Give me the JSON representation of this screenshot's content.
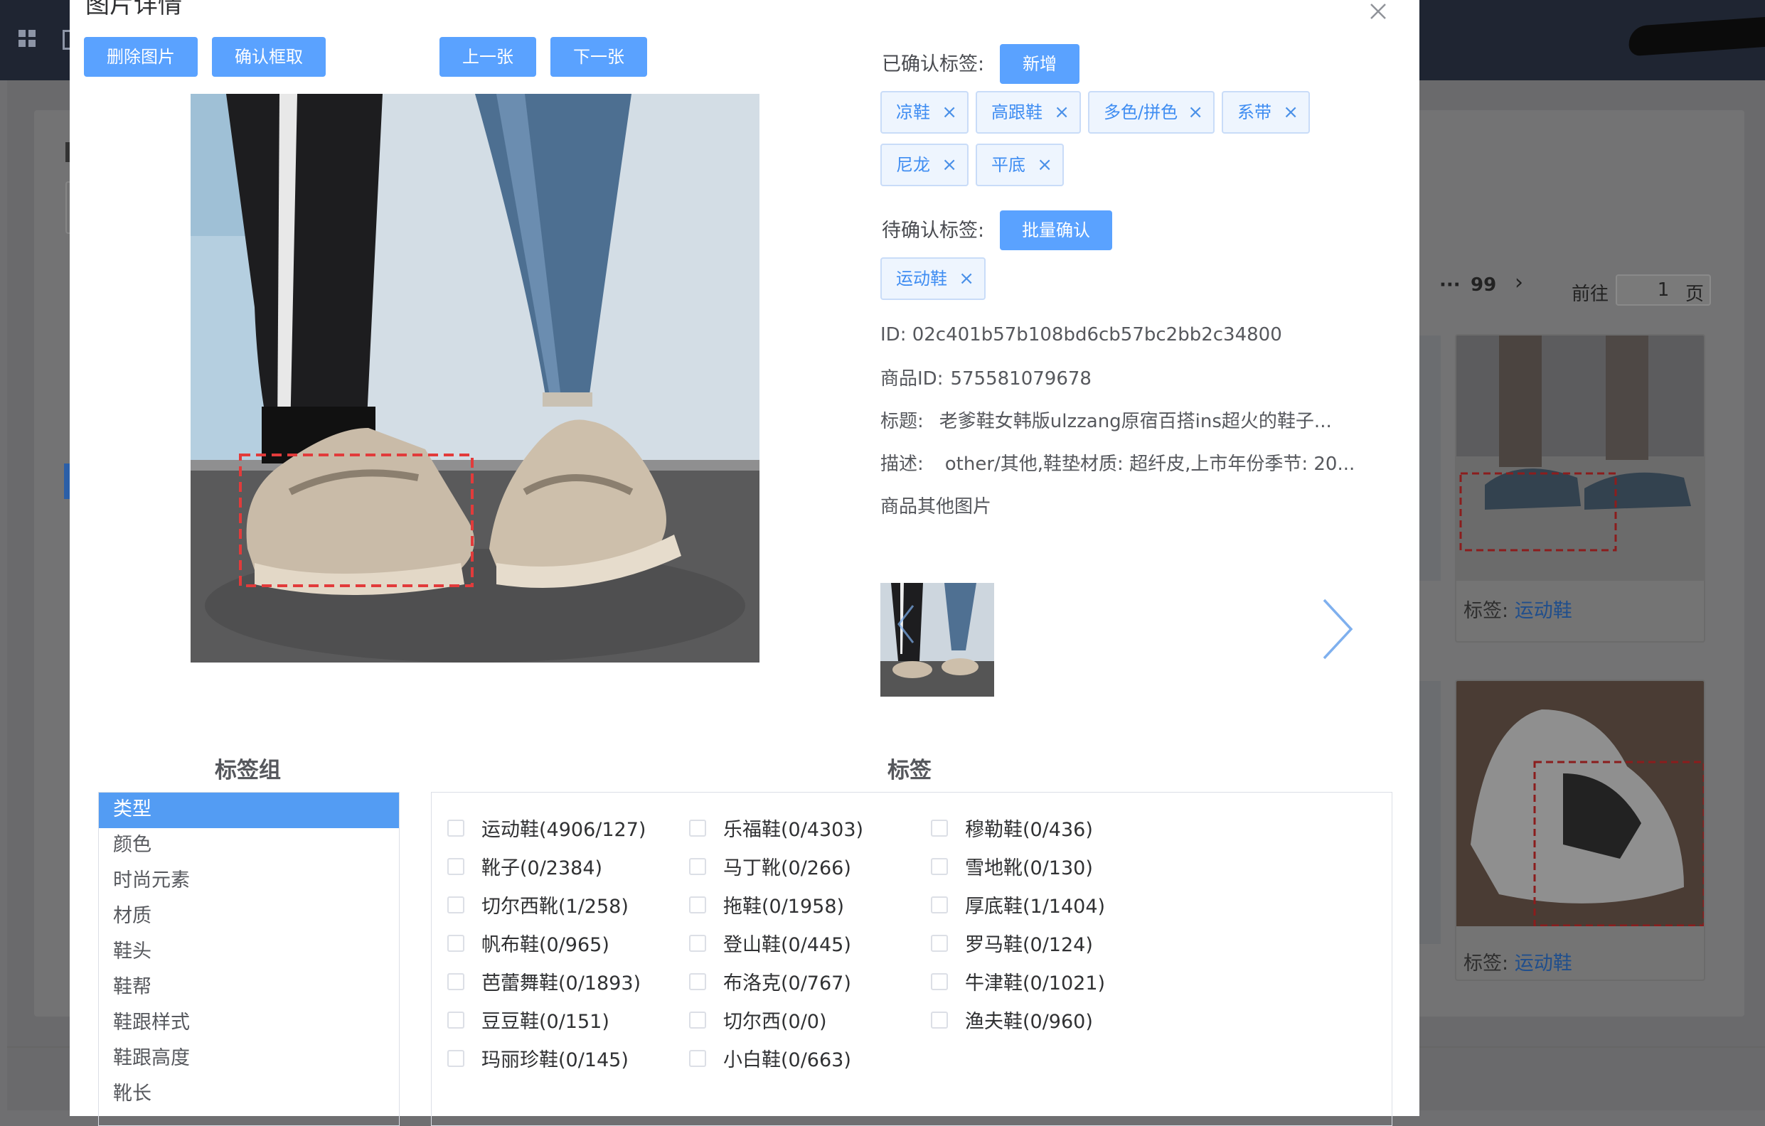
{
  "dialog": {
    "title": "图片详情",
    "buttons": {
      "delete": "删除图片",
      "confirm_box": "确认框取",
      "prev": "上一张",
      "next": "下一张"
    }
  },
  "confirmed": {
    "label": "已确认标签:",
    "add_button": "新增",
    "tags": [
      "凉鞋",
      "高跟鞋",
      "多色/拼色",
      "系带",
      "尼龙",
      "平底"
    ]
  },
  "pending": {
    "label": "待确认标签:",
    "batch_button": "批量确认",
    "tags": [
      "运动鞋"
    ]
  },
  "info": {
    "id_label": "ID:",
    "id_value": "02c401b57b108bd6cb57bc2bb2c34800",
    "product_id_label": "商品ID:",
    "product_id_value": "575581079678",
    "title_label": "标题:",
    "title_value": "老爹鞋女韩版ulzzang原宿百搭ins超火的鞋子...",
    "desc_label": "描述:",
    "desc_value": "other/其他,鞋垫材质: 超纤皮,上市年份季节: 20...",
    "other_images_label": "商品其他图片"
  },
  "sections": {
    "groups_head": "标签组",
    "tags_head": "标签"
  },
  "groups": [
    "类型",
    "颜色",
    "时尚元素",
    "材质",
    "鞋头",
    "鞋帮",
    "鞋跟样式",
    "鞋跟高度",
    "靴长"
  ],
  "tag_options": [
    [
      "运动鞋(4906/127)",
      "靴子(0/2384)",
      "切尔西靴(1/258)",
      "帆布鞋(0/965)",
      "芭蕾舞鞋(0/1893)",
      "豆豆鞋(0/151)",
      "玛丽珍鞋(0/145)"
    ],
    [
      "乐福鞋(0/4303)",
      "马丁靴(0/266)",
      "拖鞋(0/1958)",
      "登山鞋(0/445)",
      "布洛克(0/767)",
      "切尔西(0/0)",
      "小白鞋(0/663)"
    ],
    [
      "穆勒鞋(0/436)",
      "雪地靴(0/130)",
      "厚底鞋(1/1404)",
      "罗马鞋(0/124)",
      "牛津鞋(0/1021)",
      "渔夫鞋(0/960)"
    ]
  ],
  "background": {
    "pager": {
      "ellipsis": "···",
      "last_page": "99",
      "goto_label": "前往",
      "page_value": "1",
      "page_suffix": "页"
    },
    "tiles": [
      {
        "label": "标签:",
        "value": "运动鞋"
      },
      {
        "label": "标签:",
        "value": "运动鞋"
      }
    ]
  },
  "colors": {
    "primary": "#5aa2ff",
    "tag_text": "#3f8df2",
    "tag_bg": "#eef5fe",
    "active_group": "#539cf3"
  }
}
